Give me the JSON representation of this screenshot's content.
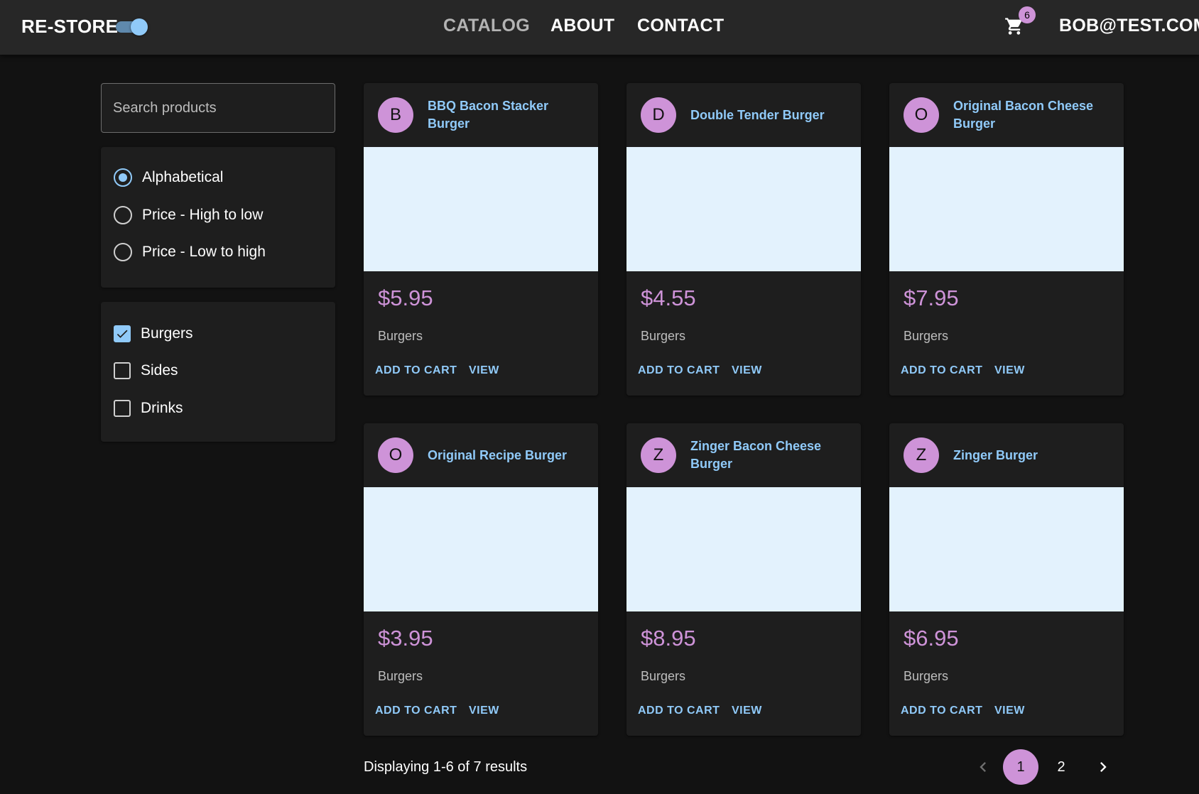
{
  "appbar": {
    "brand": "RE-STORE",
    "dark_mode": true,
    "nav": [
      "CATALOG",
      "ABOUT",
      "CONTACT"
    ],
    "active_nav": "CATALOG",
    "cart_count": "6",
    "user": "BOB@TEST.COM"
  },
  "search": {
    "placeholder": "Search products",
    "value": ""
  },
  "sort_options": [
    {
      "label": "Alphabetical",
      "selected": true
    },
    {
      "label": "Price - High to low",
      "selected": false
    },
    {
      "label": "Price - Low to high",
      "selected": false
    }
  ],
  "filter_options": [
    {
      "label": "Burgers",
      "checked": true
    },
    {
      "label": "Sides",
      "checked": false
    },
    {
      "label": "Drinks",
      "checked": false
    }
  ],
  "products": [
    {
      "initial": "B",
      "name": "BBQ Bacon Stacker Burger",
      "price": "$5.95",
      "category": "Burgers",
      "image": "bbq-bacon-stacker-burger"
    },
    {
      "initial": "D",
      "name": "Double Tender Burger",
      "price": "$4.55",
      "category": "Burgers",
      "image": "double-tender-burger"
    },
    {
      "initial": "O",
      "name": "Original Bacon Cheese Burger",
      "price": "$7.95",
      "category": "Burgers",
      "image": "original-bacon-cheese-burger"
    },
    {
      "initial": "O",
      "name": "Original Recipe Burger",
      "price": "$3.95",
      "category": "Burgers",
      "image": "original-recipe-burger"
    },
    {
      "initial": "Z",
      "name": "Zinger Bacon Cheese Burger",
      "price": "$8.95",
      "category": "Burgers",
      "image": "zinger-bacon-cheese-burger"
    },
    {
      "initial": "Z",
      "name": "Zinger Burger",
      "price": "$6.95",
      "category": "Burgers",
      "image": "zinger-burger"
    }
  ],
  "card_actions": {
    "add_to_cart": "ADD TO CART",
    "view": "VIEW"
  },
  "pagination": {
    "summary": "Displaying 1-6 of 7 results",
    "pages": [
      "1",
      "2"
    ],
    "current_page": "1"
  },
  "colors": {
    "background": "#121212",
    "surface": "#1e1e1e",
    "appbar": "#272727",
    "primary": "#90caf9",
    "secondary": "#ce93d8",
    "media_bg": "#e3f2fd"
  },
  "icons": [
    "dark-mode-switch",
    "shopping-cart-icon",
    "chevron-left-icon",
    "chevron-right-icon",
    "check-icon"
  ]
}
